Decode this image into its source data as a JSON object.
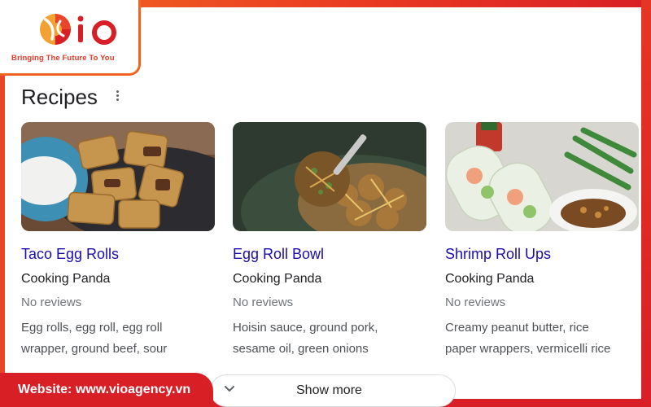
{
  "brand": {
    "logo_text": "iO",
    "tagline": "Bringing The Future To You",
    "website_label": "Website: www.vioagency.vn",
    "accent_color": "#f06423",
    "brand_red": "#d81f26"
  },
  "section": {
    "title": "Recipes",
    "more_icon": "more-vert-icon"
  },
  "recipes": [
    {
      "title": "Taco Egg Rolls",
      "source": "Cooking Panda",
      "reviews": "No reviews",
      "ingredients_line1": "Egg rolls, egg roll, egg roll",
      "ingredients_line2": "wrapper, ground beef, sour",
      "image": "taco-egg-rolls-photo"
    },
    {
      "title": "Egg Roll Bowl",
      "source": "Cooking Panda",
      "reviews": "No reviews",
      "ingredients_line1": "Hoisin sauce, ground pork,",
      "ingredients_line2": "sesame oil, green onions",
      "image": "egg-roll-bowl-photo"
    },
    {
      "title": "Shrimp Roll Ups",
      "source": "Cooking Panda",
      "reviews": "No reviews",
      "ingredients_line1": "Creamy peanut butter, rice",
      "ingredients_line2": "paper wrappers, vermicelli rice",
      "image": "shrimp-roll-ups-photo"
    }
  ],
  "show_more": {
    "label": "Show more",
    "icon": "chevron-down-icon"
  },
  "colors": {
    "link": "#1a0dab",
    "text": "#202124",
    "muted": "#70757a"
  }
}
